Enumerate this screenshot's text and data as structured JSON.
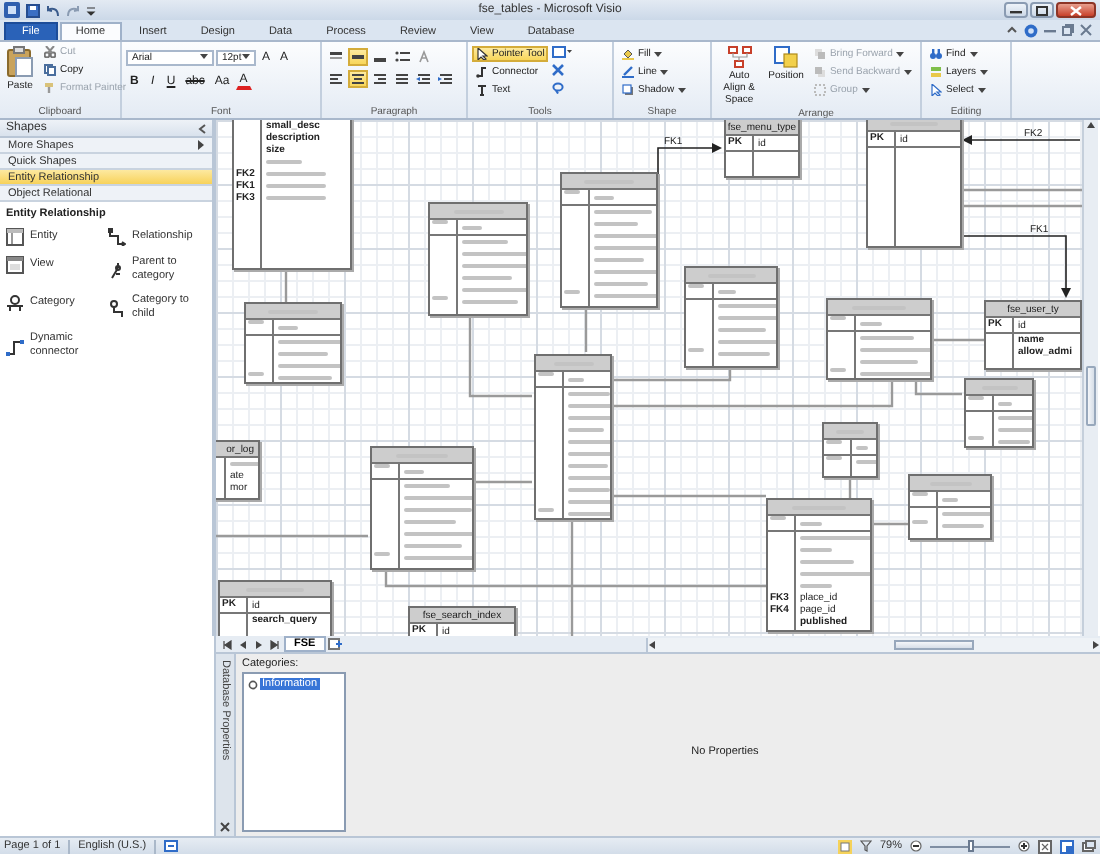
{
  "title_bar": {
    "title": "fse_tables - Microsoft Visio"
  },
  "ribbon_tabs": [
    {
      "label": "File",
      "kind": "file",
      "selected": false
    },
    {
      "label": "Home",
      "kind": "tab",
      "selected": true
    },
    {
      "label": "Insert",
      "kind": "tab",
      "selected": false
    },
    {
      "label": "Design",
      "kind": "tab",
      "selected": false
    },
    {
      "label": "Data",
      "kind": "tab",
      "selected": false
    },
    {
      "label": "Process",
      "kind": "tab",
      "selected": false
    },
    {
      "label": "Review",
      "kind": "tab",
      "selected": false
    },
    {
      "label": "View",
      "kind": "tab",
      "selected": false
    },
    {
      "label": "Database",
      "kind": "tab",
      "selected": false
    }
  ],
  "ribbon": {
    "clipboard": {
      "label": "Clipboard",
      "paste": "Paste",
      "cut": {
        "label": "Cut",
        "disabled": true
      },
      "copy": {
        "label": "Copy",
        "disabled": false
      },
      "format_painter": {
        "label": "Format Painter",
        "disabled": true
      }
    },
    "font": {
      "label": "Font",
      "font_name": "Arial",
      "font_size": "12pt",
      "grow": "A",
      "shrink": "A",
      "styles": [
        "B",
        "I",
        "U",
        "abc",
        "Aa"
      ],
      "font_color": "A"
    },
    "paragraph": {
      "label": "Paragraph",
      "vertical_align": [
        {
          "selected": false
        },
        {
          "selected": true
        },
        {
          "selected": false
        }
      ],
      "horizontal_align": [
        {
          "selected": false
        },
        {
          "selected": true
        },
        {
          "selected": false
        },
        {
          "selected": false
        }
      ]
    },
    "tools": {
      "label": "Tools",
      "items": [
        {
          "label": "Pointer Tool",
          "selected": true
        },
        {
          "label": "Connector",
          "selected": false
        },
        {
          "label": "Text",
          "selected": false
        }
      ]
    },
    "shape": {
      "label": "Shape",
      "items": [
        "Fill",
        "Line",
        "Shadow"
      ]
    },
    "arrange": {
      "label": "Arrange",
      "auto_align": "Auto Align & Space",
      "position": "Position",
      "items": [
        {
          "label": "Bring Forward",
          "disabled": true
        },
        {
          "label": "Send Backward",
          "disabled": true
        },
        {
          "label": "Group",
          "disabled": true
        }
      ]
    },
    "editing": {
      "label": "Editing",
      "items": [
        "Find",
        "Layers",
        "Select"
      ]
    }
  },
  "shapes_pane": {
    "title": "Shapes",
    "sections": [
      {
        "label": "More Shapes",
        "kind": "menu",
        "selected": false
      },
      {
        "label": "Quick Shapes",
        "kind": "stencil",
        "selected": false
      },
      {
        "label": "Entity Relationship",
        "kind": "stencil",
        "selected": true
      },
      {
        "label": "Object Relational",
        "kind": "stencil",
        "selected": false
      }
    ],
    "stencil_title": "Entity Relationship",
    "stencil_items": [
      "Entity",
      "Relationship",
      "View",
      "Parent to category",
      "Category",
      "Category to child",
      "Dynamic connector"
    ]
  },
  "diagram": {
    "entities": [
      {
        "kind": "readable",
        "rows": [
          {
            "kind": "field",
            "field": "small_desc"
          },
          {
            "kind": "field",
            "field": "description"
          },
          {
            "kind": "field",
            "field": "size"
          },
          {
            "kind": "blurred"
          },
          {
            "kind": "field",
            "key": "FK2"
          },
          {
            "kind": "field",
            "key": "FK1"
          },
          {
            "kind": "field",
            "key": "FK3"
          }
        ]
      },
      {
        "kind": "readable",
        "title": "fse_menu_type",
        "pk": {
          "key": "PK",
          "field": "id"
        }
      },
      {
        "kind": "readable",
        "pk": {
          "key": "PK",
          "field": "id"
        }
      },
      {
        "kind": "blurred"
      },
      {
        "kind": "blurred"
      },
      {
        "kind": "blurred"
      },
      {
        "kind": "blurred"
      },
      {
        "kind": "blurred"
      },
      {
        "kind": "readable",
        "title": "fse_user_ty",
        "pk": {
          "key": "PK",
          "field": "id"
        },
        "rows": [
          {
            "kind": "field",
            "field": "name"
          },
          {
            "kind": "field",
            "field": "allow_admi"
          }
        ]
      },
      {
        "kind": "blurred"
      },
      {
        "kind": "blurred"
      },
      {
        "kind": "readable",
        "title": "or_log",
        "rows": [
          {
            "kind": "blurred"
          },
          {
            "kind": "field",
            "field": "ate"
          },
          {
            "kind": "field",
            "field": "mor"
          }
        ]
      },
      {
        "kind": "blurred"
      },
      {
        "kind": "blurred"
      },
      {
        "kind": "blurred"
      },
      {
        "kind": "readable",
        "pk": {
          "key": "PK",
          "field": "id"
        },
        "rows": [
          {
            "kind": "field",
            "field": "search_query"
          }
        ]
      },
      {
        "kind": "readable",
        "title": "fse_search_index",
        "pk": {
          "key": "PK",
          "field": "id"
        }
      },
      {
        "kind": "readable",
        "rows": [
          {
            "kind": "blurred"
          },
          {
            "kind": "blurred"
          },
          {
            "kind": "blurred"
          },
          {
            "kind": "blurred"
          },
          {
            "kind": "blurred"
          },
          {
            "kind": "field",
            "key": "FK3",
            "field": "place_id"
          },
          {
            "kind": "field",
            "key": "FK4",
            "field": "page_id"
          },
          {
            "kind": "field",
            "field": "published"
          }
        ]
      }
    ],
    "relationship_labels": [
      "FK1",
      "FK2",
      "FK1"
    ]
  },
  "page_tabs": [
    {
      "label": "FSE",
      "selected": true
    }
  ],
  "properties_panel": {
    "title": "Database Properties",
    "categories_label": "Categories:",
    "categories": [
      {
        "label": "Information",
        "selected": true
      }
    ],
    "message": "No Properties"
  },
  "status_bar": {
    "page": "Page 1 of 1",
    "language": "English (U.S.)",
    "zoom": "79%",
    "zoom_slider": {
      "level": 0.5
    }
  }
}
